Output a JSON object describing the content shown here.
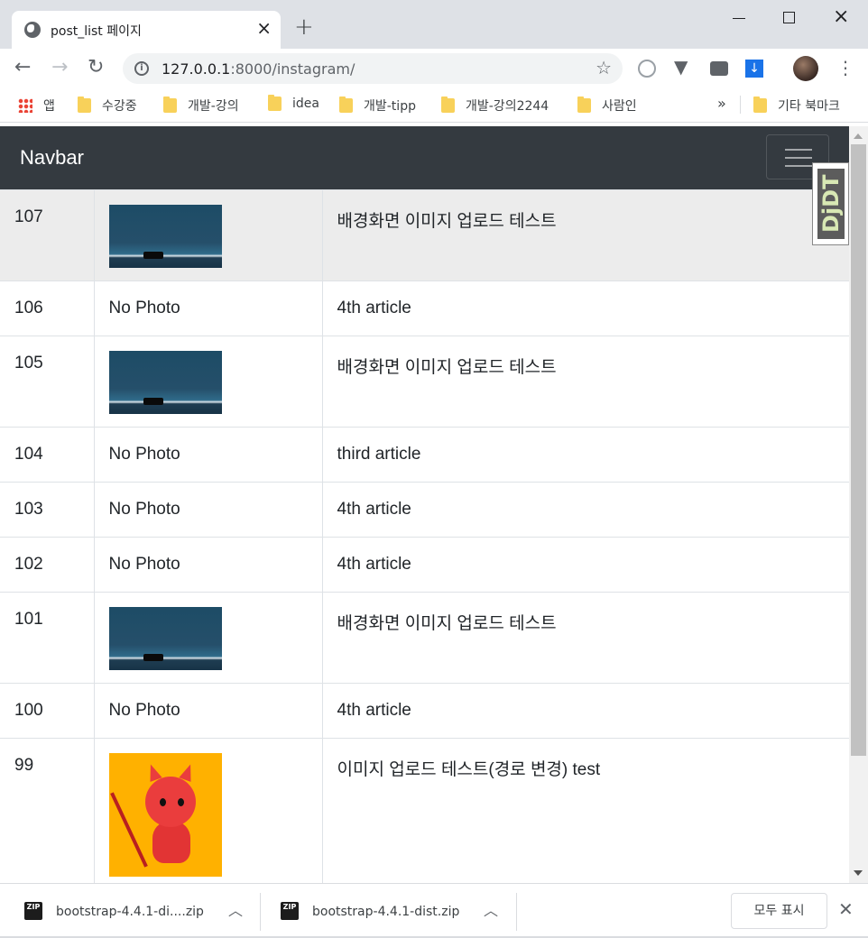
{
  "browser": {
    "tab_title": "post_list 페이지",
    "new_tab": "+",
    "url_host": "127.0.0.1",
    "url_rest": ":8000/instagram/",
    "bookmarks": [
      "앱",
      "수강중",
      "개발-강의",
      "idea",
      "개발-tipp",
      "개발-강의2244",
      "사람인"
    ],
    "bookmarks_more": "»",
    "other_bookmarks": "기타 북마크"
  },
  "page": {
    "navbar_brand": "Navbar",
    "debug_toolbar": "DjDT",
    "rows": [
      {
        "id": "107",
        "photo": "",
        "has_photo": true,
        "title": "배경화면 이미지 업로드 테스트"
      },
      {
        "id": "106",
        "photo": "No Photo",
        "has_photo": false,
        "title": "4th article"
      },
      {
        "id": "105",
        "photo": "",
        "has_photo": true,
        "title": "배경화면 이미지 업로드 테스트"
      },
      {
        "id": "104",
        "photo": "No Photo",
        "has_photo": false,
        "title": "third article"
      },
      {
        "id": "103",
        "photo": "No Photo",
        "has_photo": false,
        "title": "4th article"
      },
      {
        "id": "102",
        "photo": "No Photo",
        "has_photo": false,
        "title": "4th article"
      },
      {
        "id": "101",
        "photo": "",
        "has_photo": true,
        "title": "배경화면 이미지 업로드 테스트"
      },
      {
        "id": "100",
        "photo": "No Photo",
        "has_photo": false,
        "title": "4th article"
      },
      {
        "id": "99",
        "photo": "",
        "has_photo": true,
        "title": "이미지 업로드 테스트(경로 변경) test"
      }
    ]
  },
  "downloads": {
    "items": [
      "bootstrap-4.4.1-di....zip",
      "bootstrap-4.4.1-dist.zip"
    ],
    "zip_label": "ZIP",
    "show_all": "모두 표시"
  },
  "colors": {
    "navbar_bg": "#343a40",
    "hover_row": "#ececec",
    "border": "#dee2e6"
  }
}
